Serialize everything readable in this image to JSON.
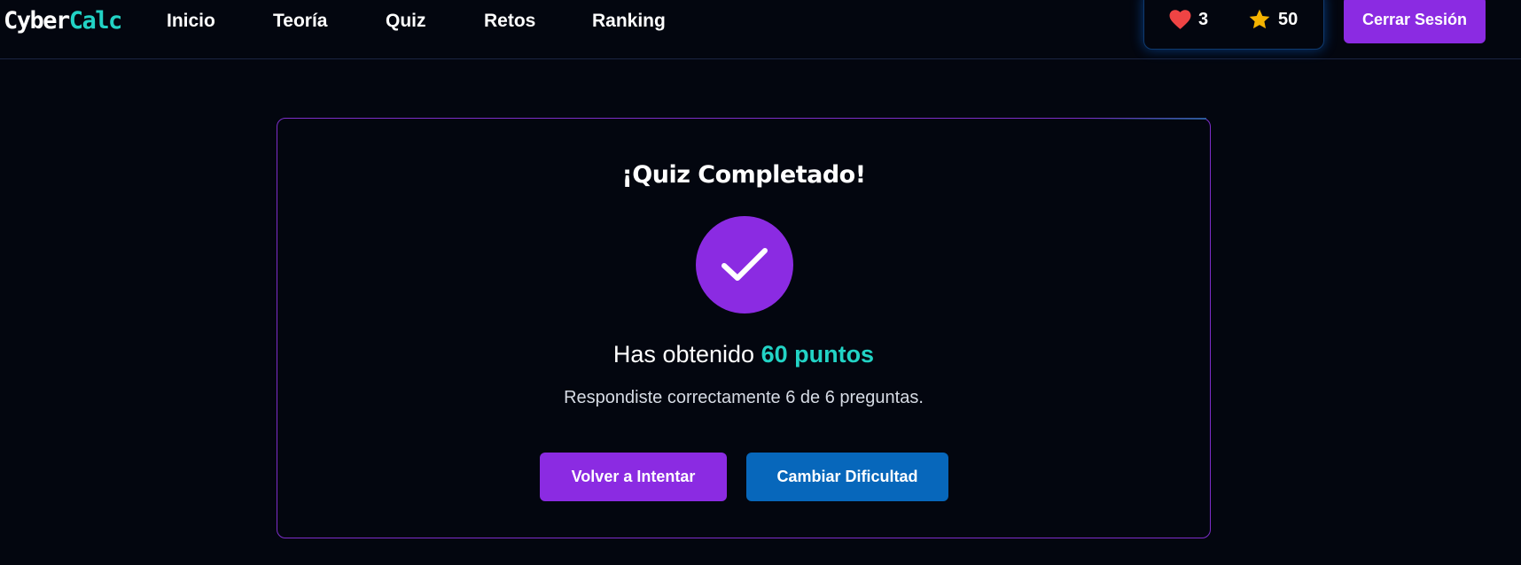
{
  "nav": {
    "logo_part1": "Cyber",
    "logo_part2": "Calc",
    "links": [
      "Inicio",
      "Teoría",
      "Quiz",
      "Retos",
      "Ranking"
    ]
  },
  "stats": {
    "lives": "3",
    "points": "50",
    "lives_icon": "heart-icon",
    "points_icon": "star-icon"
  },
  "logout_label": "Cerrar Sesión",
  "result": {
    "title": "¡Quiz Completado!",
    "score_prefix": "Has obtenido",
    "score_value": "60 puntos",
    "summary": "Respondiste correctamente 6 de 6 preguntas.",
    "retry_label": "Volver a Intentar",
    "change_label": "Cambiar Dificultad",
    "check_icon": "checkmark-icon"
  },
  "colors": {
    "background": "#03060f",
    "accent_purple": "#8b2be2",
    "accent_teal": "#22d3c5",
    "accent_blue": "#0767bb",
    "heart_red": "#ef4444",
    "star_yellow": "#f5b301"
  }
}
